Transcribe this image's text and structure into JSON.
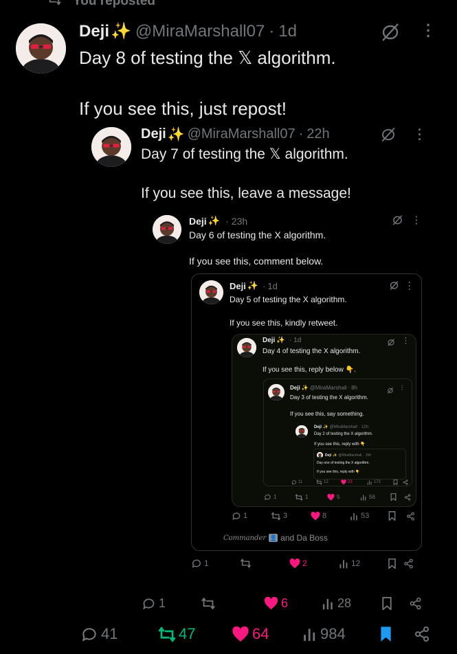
{
  "header": {
    "repost_label": "You reposted"
  },
  "colors": {
    "like": "#f91880",
    "repost": "#00ba7c",
    "bookmark": "#1d9bf0",
    "muted": "#71767b"
  },
  "posts": [
    {
      "name": "Deji",
      "handle": "@MiraMarshall07",
      "time": "1d",
      "line1": "Day 8 of testing the 𝕏 algorithm.",
      "line2": "If you see this, just repost!",
      "replies": "41",
      "reposts": "47",
      "likes": "64",
      "views": "984"
    },
    {
      "name": "Deji",
      "handle": "@MiraMarshall07",
      "time": "22h",
      "line1": "Day 7 of testing the 𝕏 algorithm.",
      "line2": "If you see this, leave a message!",
      "replies": "1",
      "reposts": "",
      "likes": "6",
      "views": "28"
    },
    {
      "name": "Deji",
      "time": "23h",
      "line1": "Day 6 of testing the X algorithm.",
      "line2": "If you see this, comment below.",
      "replies": "1",
      "reposts": "",
      "likes": "2",
      "views": "12"
    },
    {
      "name": "Deji",
      "time": "1d",
      "line1": "Day 5 of testing the X algorithm.",
      "line2": "If you see this, kindly retweet.",
      "replies": "1",
      "reposts": "3",
      "likes": "8",
      "views": "53"
    },
    {
      "name": "Deji",
      "time": "1d",
      "line1": "Day 4 of testing the X algorithm.",
      "line2": "If you see this, reply below 👇.",
      "replies": "1",
      "reposts": "1",
      "likes": "5",
      "views": "56"
    },
    {
      "name": "Deji",
      "handle": "@MiraMarshall",
      "time": "8h",
      "line1": "Day 3 of testing the X algorithm.",
      "line2": "If you see this, say something.",
      "replies": "11",
      "reposts": "12",
      "likes": "23",
      "views": "172"
    },
    {
      "name": "Deji",
      "handle": "@MiraMarshall",
      "time": "12h",
      "line1": "Day 2 of testing the X algorithm.",
      "line2": "If you see this, reply with 👇"
    },
    {
      "name": "Deji",
      "handle": "@MiraMarshall",
      "time": "15h",
      "line1": "Day one of testing the X algorithm.",
      "line2": "If you see this, reply with 👇"
    }
  ],
  "footer_note": {
    "text": "Commander",
    "suffix": "and Da Boss"
  }
}
